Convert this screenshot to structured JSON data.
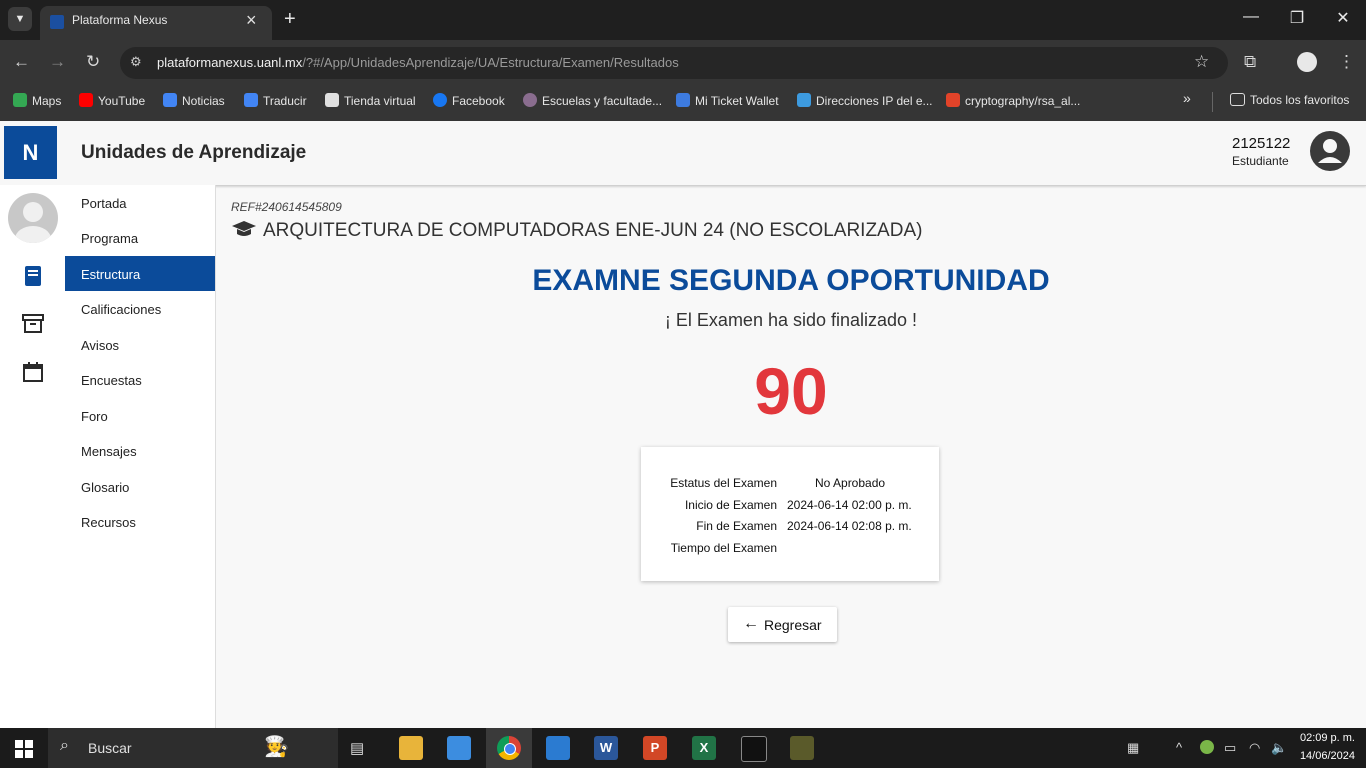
{
  "browser": {
    "tab_title": "Plataforma Nexus",
    "url_host": "plataformanexus.uanl.mx",
    "url_path": "/?#/App/UnidadesAprendizaje/UA/Estructura/Examen/Resultados",
    "bookmarks": [
      {
        "label": "Maps",
        "color": "#34a853"
      },
      {
        "label": "YouTube",
        "color": "#ff0000"
      },
      {
        "label": "Noticias",
        "color": "#4285f4"
      },
      {
        "label": "Traducir",
        "color": "#4285f4"
      },
      {
        "label": "Tienda virtual",
        "color": "#e0e0e0"
      },
      {
        "label": "Facebook",
        "color": "#1877f2"
      },
      {
        "label": "Escuelas y facultade...",
        "color": "#8a6d8f"
      },
      {
        "label": "Mi Ticket Wallet",
        "color": "#3d7be0"
      },
      {
        "label": "Direcciones IP del e...",
        "color": "#3d9be0"
      },
      {
        "label": "cryptography/rsa_al...",
        "color": "#e24329"
      }
    ],
    "all_bookmarks": "Todos los favoritos"
  },
  "app": {
    "logo": "N",
    "title": "Unidades de Aprendizaje",
    "user_id": "2125122",
    "user_role": "Estudiante"
  },
  "nav": [
    {
      "label": "Portada",
      "active": false
    },
    {
      "label": "Programa",
      "active": false
    },
    {
      "label": "Estructura",
      "active": true
    },
    {
      "label": "Calificaciones",
      "active": false
    },
    {
      "label": "Avisos",
      "active": false
    },
    {
      "label": "Encuestas",
      "active": false
    },
    {
      "label": "Foro",
      "active": false
    },
    {
      "label": "Mensajes",
      "active": false
    },
    {
      "label": "Glosario",
      "active": false
    },
    {
      "label": "Recursos",
      "active": false
    }
  ],
  "exam": {
    "ref": "REF#240614545809",
    "course": "ARQUITECTURA DE COMPUTADORAS ENE-JUN 24 (NO ESCOLARIZADA)",
    "title": "EXAMNE SEGUNDA OPORTUNIDAD",
    "message": "¡ El Examen ha sido finalizado !",
    "score": "90",
    "details": [
      {
        "label": "Estatus del Examen",
        "value": "No Aprobado"
      },
      {
        "label": "Inicio de Examen",
        "value": "2024-06-14 02:00 p. m."
      },
      {
        "label": "Fin de Examen",
        "value": "2024-06-14 02:08 p. m."
      },
      {
        "label": "Tiempo del Examen",
        "value": ""
      }
    ],
    "back_button": "Regresar"
  },
  "taskbar": {
    "search_placeholder": "Buscar",
    "time": "02:09 p. m.",
    "date": "14/06/2024"
  },
  "colors": {
    "brand": "#0b4b9a",
    "score": "#e2373c"
  }
}
